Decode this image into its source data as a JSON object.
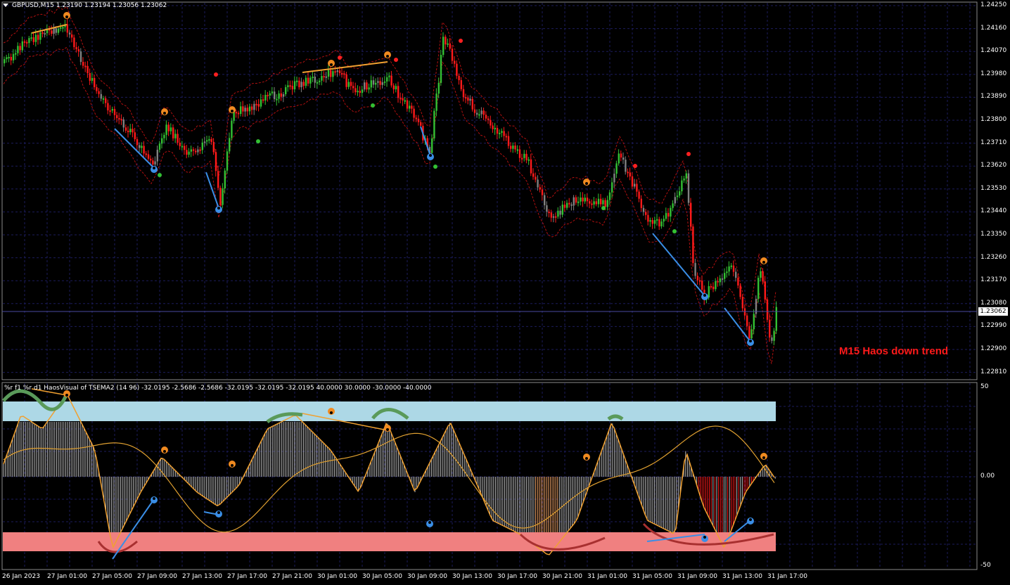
{
  "window": {
    "symbol_line": "GBPUSD,M15  1.23190 1.23194 1.23056 1.23062",
    "current_price": "1.23062",
    "trend_label": "M15 Haos down trend"
  },
  "price_axis": [
    "1.24250",
    "1.24160",
    "1.24070",
    "1.23980",
    "1.23890",
    "1.23800",
    "1.23710",
    "1.23620",
    "1.23530",
    "1.23440",
    "1.23350",
    "1.23260",
    "1.23170",
    "1.23080",
    "1.22990",
    "1.22900",
    "1.22810"
  ],
  "time_axis": [
    "26 Jan 2023",
    "27 Jan 01:00",
    "27 Jan 05:00",
    "27 Jan 09:00",
    "27 Jan 13:00",
    "27 Jan 17:00",
    "27 Jan 21:00",
    "30 Jan 01:00",
    "30 Jan 05:00",
    "30 Jan 09:00",
    "30 Jan 13:00",
    "30 Jan 17:00",
    "30 Jan 21:00",
    "31 Jan 01:00",
    "31 Jan 05:00",
    "31 Jan 09:00",
    "31 Jan 13:00",
    "31 Jan 17:00"
  ],
  "indicator": {
    "title": "%r f1 %r d1 HaosVisual of TSEMA2 (14 96) -32.0195 -2.5686 -2.5686 -32.0195 -32.0195 -32.0195 40.0000 30.0000 -30.0000 -40.0000",
    "axis": [
      "50",
      "0.00",
      "-50"
    ]
  },
  "colors": {
    "background": "#000000",
    "grid": "#1c1c5c",
    "bull": "#33c033",
    "bear": "#ff1a1a",
    "neutral": "#808080",
    "overbought_zone": "#add8e6",
    "oversold_zone": "#f08080",
    "orange_line": "#f0a030",
    "blue_line": "#3a8ee6",
    "trend_label": "#ff1a1a"
  },
  "icons": [
    "collapse-arrow-icon",
    "fractal-up-icon",
    "fractal-down-icon",
    "signal-dot-icon"
  ]
}
